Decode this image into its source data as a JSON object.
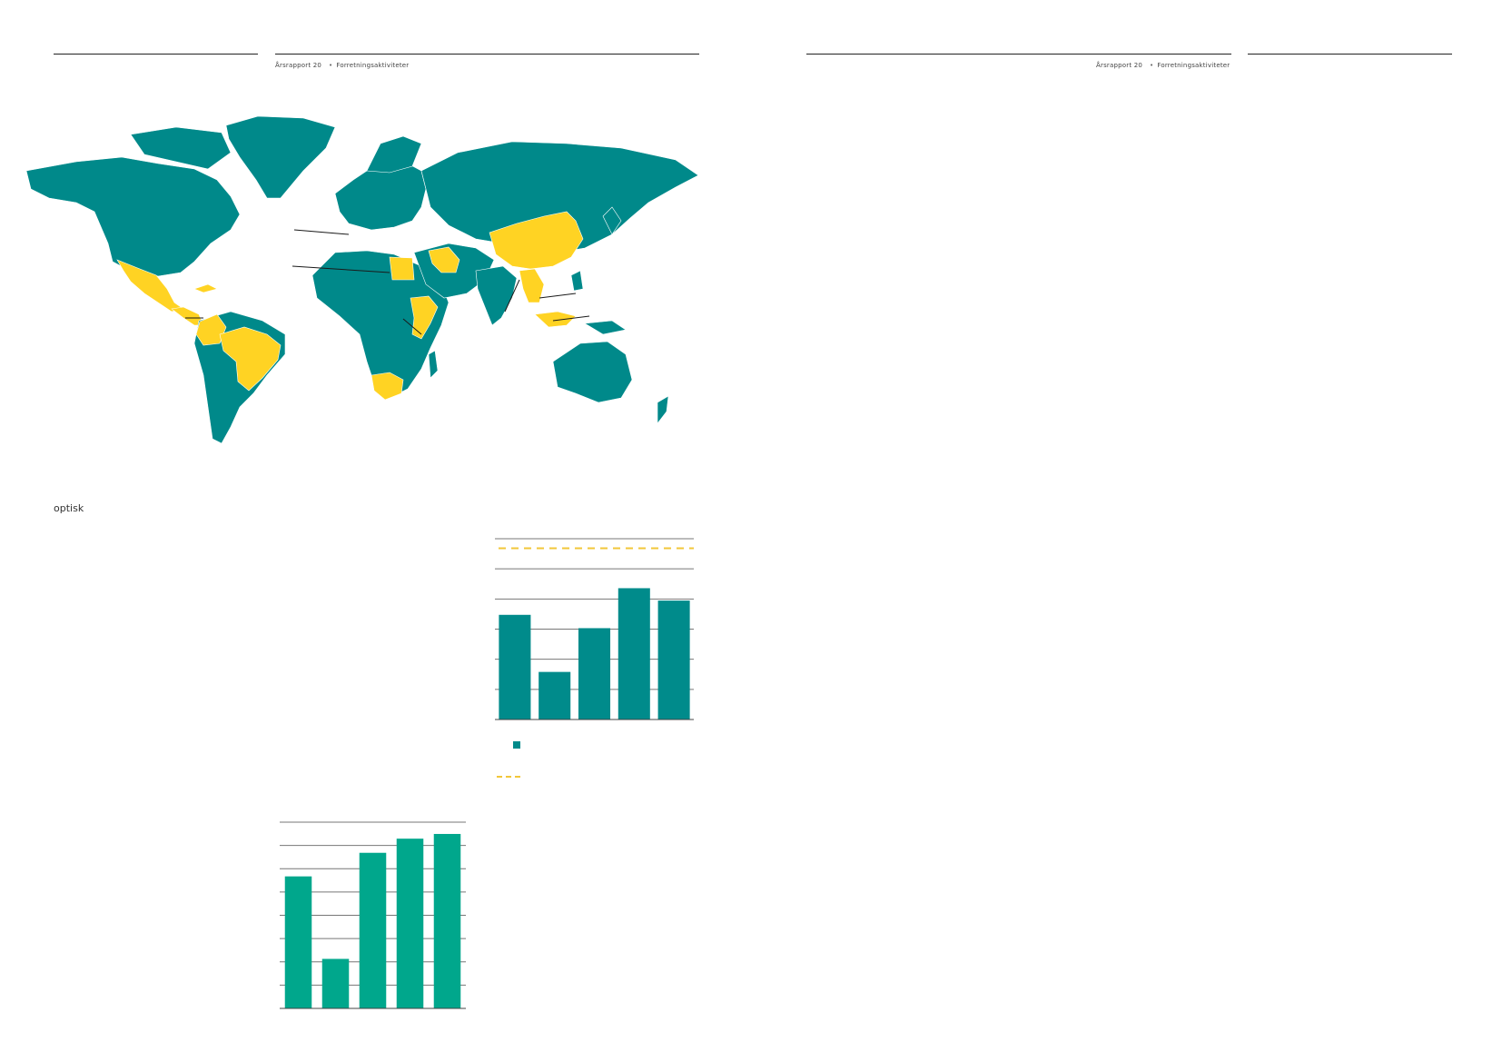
{
  "colors": {
    "map_base": "#00898A",
    "map_highlight": "#FFD323",
    "bar_chart1": "#008B8B",
    "bar_chart2": "#00A78C",
    "dashed_line": "#F2C73A",
    "gridline": "#777777"
  },
  "header_left": {
    "report": "Årsrapport 20",
    "section": "Forretningsaktiviteter"
  },
  "header_right": {
    "report": "Årsrapport 20",
    "section": "Forretningsaktiviteter"
  },
  "body": {
    "word": "optisk"
  },
  "map": {
    "highlighted_regions": [
      "Mexico",
      "Central America",
      "Colombia",
      "Brazil",
      "Egypt",
      "Iran",
      "China",
      "Thailand",
      "Vietnam",
      "Indonesia",
      "Ethiopia",
      "Kenya",
      "South Africa"
    ]
  },
  "chart_data": [
    {
      "type": "bar",
      "values": [
        110,
        50,
        96,
        138,
        125
      ],
      "ylim": [
        0,
        190
      ],
      "grid": true,
      "reference_line": 180
    },
    {
      "type": "bar",
      "values": [
        112,
        42,
        132,
        144,
        148
      ],
      "ylim": [
        0,
        158
      ],
      "grid": true
    }
  ],
  "legend": {
    "items": [
      {
        "marker": "square"
      },
      {
        "marker": "dashed-line"
      }
    ]
  }
}
